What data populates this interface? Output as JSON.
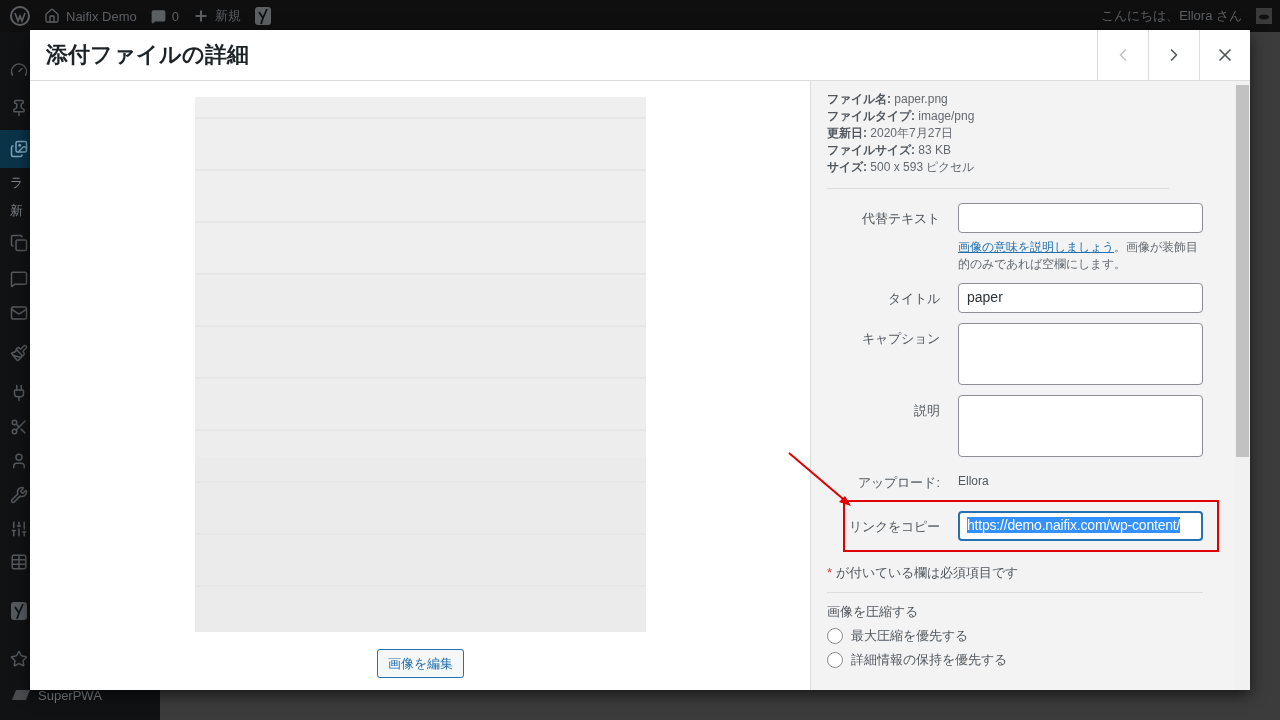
{
  "admin_bar": {
    "site_name": "Naifix Demo",
    "comment_count": "0",
    "new_label": "新規",
    "greeting": "こんにちは、Ellora さん"
  },
  "sidebar": {
    "items": [
      {
        "kind": "icon",
        "selected": false
      },
      {
        "kind": "icon",
        "selected": false
      },
      {
        "kind": "icon",
        "selected": true
      },
      {
        "kind": "text",
        "label": "ラ",
        "selected": false
      },
      {
        "kind": "text",
        "label": "新",
        "selected": false
      },
      {
        "kind": "icon",
        "selected": false
      },
      {
        "kind": "icon",
        "selected": false
      },
      {
        "kind": "icon",
        "selected": false
      },
      {
        "kind": "icon",
        "selected": false
      },
      {
        "kind": "icon",
        "selected": false
      },
      {
        "kind": "icon",
        "selected": false
      },
      {
        "kind": "icon",
        "selected": false
      },
      {
        "kind": "icon",
        "selected": false
      },
      {
        "kind": "icon",
        "selected": false
      },
      {
        "kind": "icon",
        "selected": false
      },
      {
        "kind": "icon",
        "selected": false
      },
      {
        "kind": "icon",
        "selected": false
      },
      {
        "kind": "text",
        "label": "SuperPWA",
        "selected": false
      }
    ]
  },
  "modal": {
    "title": "添付ファイルの詳細",
    "nav": [
      {
        "kind": "prev",
        "disabled": true
      },
      {
        "kind": "next",
        "disabled": false
      },
      {
        "kind": "close",
        "disabled": false
      }
    ],
    "preview": {
      "kind": "picture",
      "edit_button": "画像を編集"
    },
    "file_info": [
      {
        "label": "ファイル名:",
        "value": "paper.png"
      },
      {
        "label": "ファイルタイプ:",
        "value": "image/png"
      },
      {
        "label": "更新日:",
        "value": "2020年7月27日"
      },
      {
        "label": "ファイルサイズ:",
        "value": "83 KB"
      },
      {
        "label": "サイズ:",
        "value": "500 x 593 ピクセル"
      }
    ],
    "fields": [
      {
        "kind": "input",
        "label": "代替テキスト",
        "help_link": "画像の意味を説明しましょう",
        "help_text": "。画像が装飾目的のみであれば空欄にします。"
      },
      {
        "kind": "input",
        "label": "タイトル",
        "value": "paper"
      },
      {
        "kind": "textarea",
        "label": "キャプション"
      },
      {
        "kind": "textarea",
        "label": "説明"
      },
      {
        "kind": "static",
        "label": "アップロード:",
        "value": "Ellora"
      },
      {
        "kind": "link",
        "label": "リンクをコピー",
        "value": "https://demo.naifix.com/wp-content/",
        "focused": true,
        "highlighted": true
      }
    ],
    "required_mark": "*",
    "required_note": "が付いている欄は必須項目です",
    "compress": {
      "title": "画像を圧縮する",
      "options": [
        {
          "label": "最大圧縮を優先する",
          "selected": false
        },
        {
          "label": "詳細情報の保持を優先する",
          "selected": false
        }
      ]
    }
  }
}
